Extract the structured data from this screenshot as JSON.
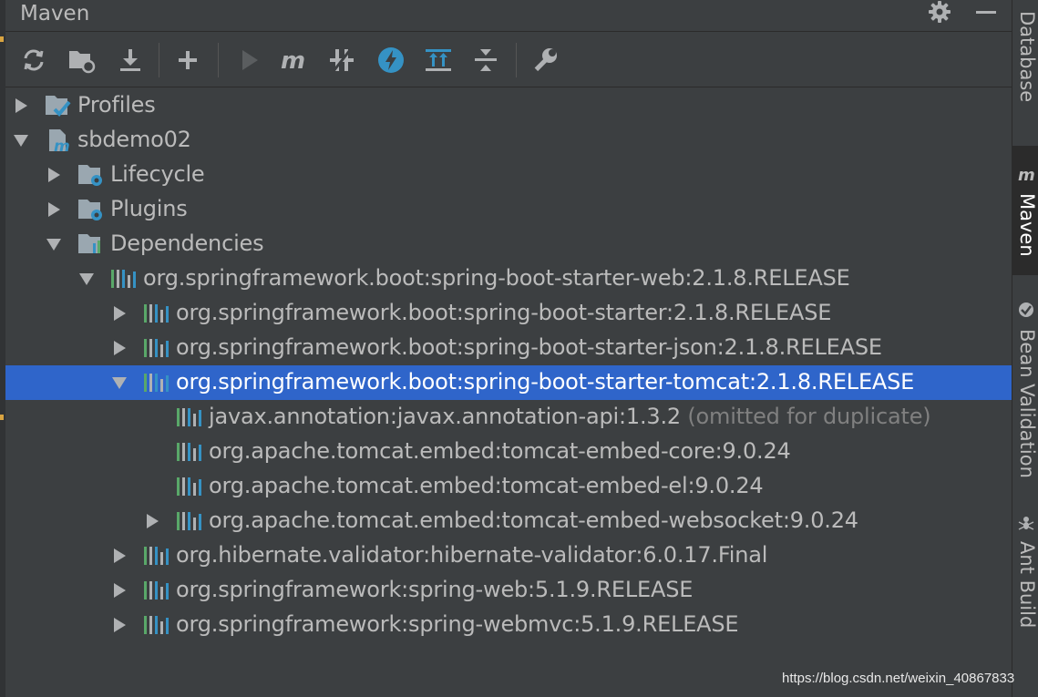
{
  "panel": {
    "title": "Maven"
  },
  "toolbar": {
    "buttons": [
      {
        "name": "reload-icon"
      },
      {
        "name": "generate-sources-icon"
      },
      {
        "name": "download-icon"
      },
      {
        "name": "add-icon"
      },
      {
        "name": "run-icon"
      },
      {
        "name": "execute-goal-icon"
      },
      {
        "name": "toggle-offline-icon"
      },
      {
        "name": "skip-tests-icon"
      },
      {
        "name": "show-dependencies-icon"
      },
      {
        "name": "collapse-all-icon"
      },
      {
        "name": "settings-wrench-icon"
      }
    ]
  },
  "tree": {
    "profiles": "Profiles",
    "project": "sbdemo02",
    "lifecycle": "Lifecycle",
    "plugins": "Plugins",
    "dependencies": "Dependencies",
    "dep_web": "org.springframework.boot:spring-boot-starter-web:2.1.8.RELEASE",
    "dep_starter": "org.springframework.boot:spring-boot-starter:2.1.8.RELEASE",
    "dep_json": "org.springframework.boot:spring-boot-starter-json:2.1.8.RELEASE",
    "dep_tomcat": "org.springframework.boot:spring-boot-starter-tomcat:2.1.8.RELEASE",
    "dep_annotation": "javax.annotation:javax.annotation-api:1.3.2",
    "dep_annotation_note": "(omitted for duplicate)",
    "dep_tomcat_core": "org.apache.tomcat.embed:tomcat-embed-core:9.0.24",
    "dep_tomcat_el": "org.apache.tomcat.embed:tomcat-embed-el:9.0.24",
    "dep_tomcat_websocket": "org.apache.tomcat.embed:tomcat-embed-websocket:9.0.24",
    "dep_hibernate": "org.hibernate.validator:hibernate-validator:6.0.17.Final",
    "dep_spring_web": "org.springframework:spring-web:5.1.9.RELEASE",
    "dep_spring_webmvc": "org.springframework:spring-webmvc:5.1.9.RELEASE"
  },
  "right_tabs": {
    "database": "Database",
    "maven": "Maven",
    "bean_validation": "Bean Validation",
    "ant_build": "Ant Build"
  },
  "watermark": "https://blog.csdn.net/weixin_40867833",
  "colors": {
    "background": "#3c3f41",
    "selection": "#2f65ca",
    "text": "#bbbbbb",
    "muted_text": "#808080",
    "accent_blue": "#3592c4"
  }
}
